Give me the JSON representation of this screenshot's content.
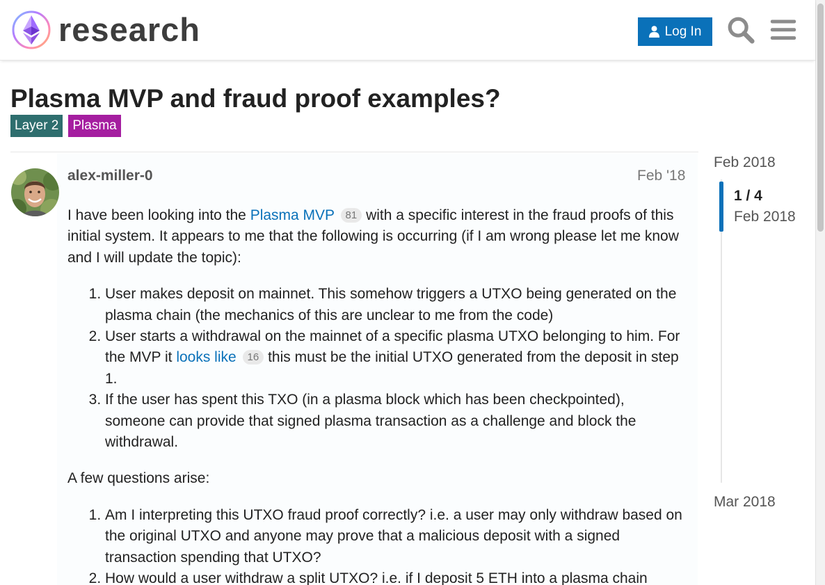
{
  "header": {
    "site_name": "research",
    "login_label": "Log In",
    "icons": [
      "ethereum-logo-icon",
      "user-icon",
      "search-icon",
      "hamburger-menu-icon"
    ]
  },
  "topic": {
    "title": "Plasma MVP and fraud proof examples?",
    "tags": [
      {
        "label": "Layer 2",
        "color": "#2e6e6e"
      },
      {
        "label": "Plasma",
        "color": "#a51ea0"
      }
    ]
  },
  "post": {
    "username": "alex-miller-0",
    "date": "Feb '18",
    "p1": {
      "before": "I have been looking into the ",
      "link": "Plasma MVP",
      "link_clicks": "81",
      "after": " with a specific interest in the fraud proofs of this initial system. It appears to me that the following is occurring (if I am wrong please let me know and I will update the topic):"
    },
    "list1": {
      "item1": "User makes deposit on mainnet. This somehow triggers a UTXO being generated on the plasma chain (the mechanics of this are unclear to me from the code)",
      "item2_before": "User starts a withdrawal on the mainnet of a specific plasma UTXO belonging to him. For the MVP it ",
      "item2_link": "looks like",
      "item2_clicks": "16",
      "item2_after": " this must be the initial UTXO generated from the deposit in step 1.",
      "item3": "If the user has spent this TXO (in a plasma block which has been checkpointed), someone can provide that signed plasma transaction as a challenge and block the withdrawal."
    },
    "p2": "A few questions arise:",
    "list2": {
      "item1": "Am I interpreting this UTXO fraud proof correctly? i.e. a user may only withdraw based on the original UTXO and anyone may prove that a malicious deposit with a signed transaction spending that UTXO?",
      "item2": "How would a user withdraw a split UTXO? i.e. if I deposit 5 ETH into a plasma chain"
    }
  },
  "timeline": {
    "start": "Feb 2018",
    "progress": "1 / 4",
    "progress_fraction": 0.25,
    "progress_date": "Feb 2018",
    "end": "Mar 2018"
  },
  "colors": {
    "accent": "#0a71b9",
    "tag_layer2": "#2e6e6e",
    "tag_plasma": "#a51ea0"
  }
}
